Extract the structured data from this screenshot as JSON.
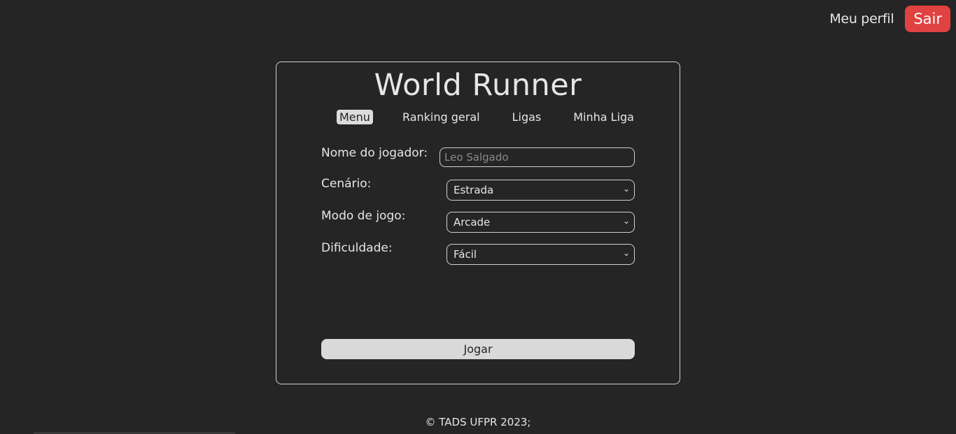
{
  "header": {
    "profile_label": "Meu perfil",
    "logout_label": "Sair"
  },
  "card": {
    "title": "World Runner",
    "nav": [
      {
        "label": "Menu",
        "active": true
      },
      {
        "label": "Ranking geral",
        "active": false
      },
      {
        "label": "Ligas",
        "active": false
      },
      {
        "label": "Minha Liga",
        "active": false
      }
    ],
    "form": {
      "player_label": "Nome do jogador:",
      "player_placeholder": "Leo Salgado",
      "scenario_label": "Cenário:",
      "scenario_value": "Estrada",
      "mode_label": "Modo de jogo:",
      "mode_value": "Arcade",
      "difficulty_label": "Dificuldade:",
      "difficulty_value": "Fácil",
      "play_label": "Jogar"
    }
  },
  "footer": {
    "text": "© TADS UFPR 2023;"
  },
  "colors": {
    "background": "#252525",
    "text": "#e6e6e6",
    "logout": "#e04242",
    "active_nav": "#dcdcdc"
  }
}
